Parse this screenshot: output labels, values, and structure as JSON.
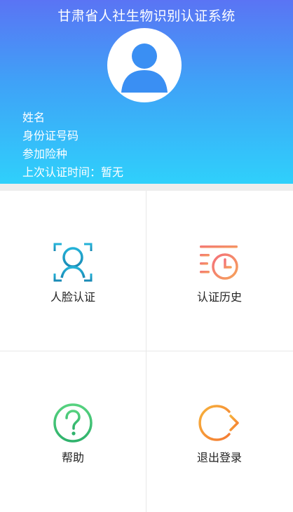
{
  "header": {
    "title": "甘肃省人社生物识别认证系统",
    "info": {
      "name_label": "姓名",
      "id_label": "身份证号码",
      "insurance_label": "参加险种",
      "last_auth": "上次认证时间：暂无"
    }
  },
  "menu": {
    "items": [
      {
        "label": "人脸认证",
        "icon": "face-scan-icon",
        "color": "#1aa0c9"
      },
      {
        "label": "认证历史",
        "icon": "history-clock-icon",
        "color": "#f08a68"
      },
      {
        "label": "帮助",
        "icon": "help-question-icon",
        "color": "#43c37a"
      },
      {
        "label": "退出登录",
        "icon": "logout-arrow-icon",
        "color": "#f59a3a"
      }
    ]
  }
}
